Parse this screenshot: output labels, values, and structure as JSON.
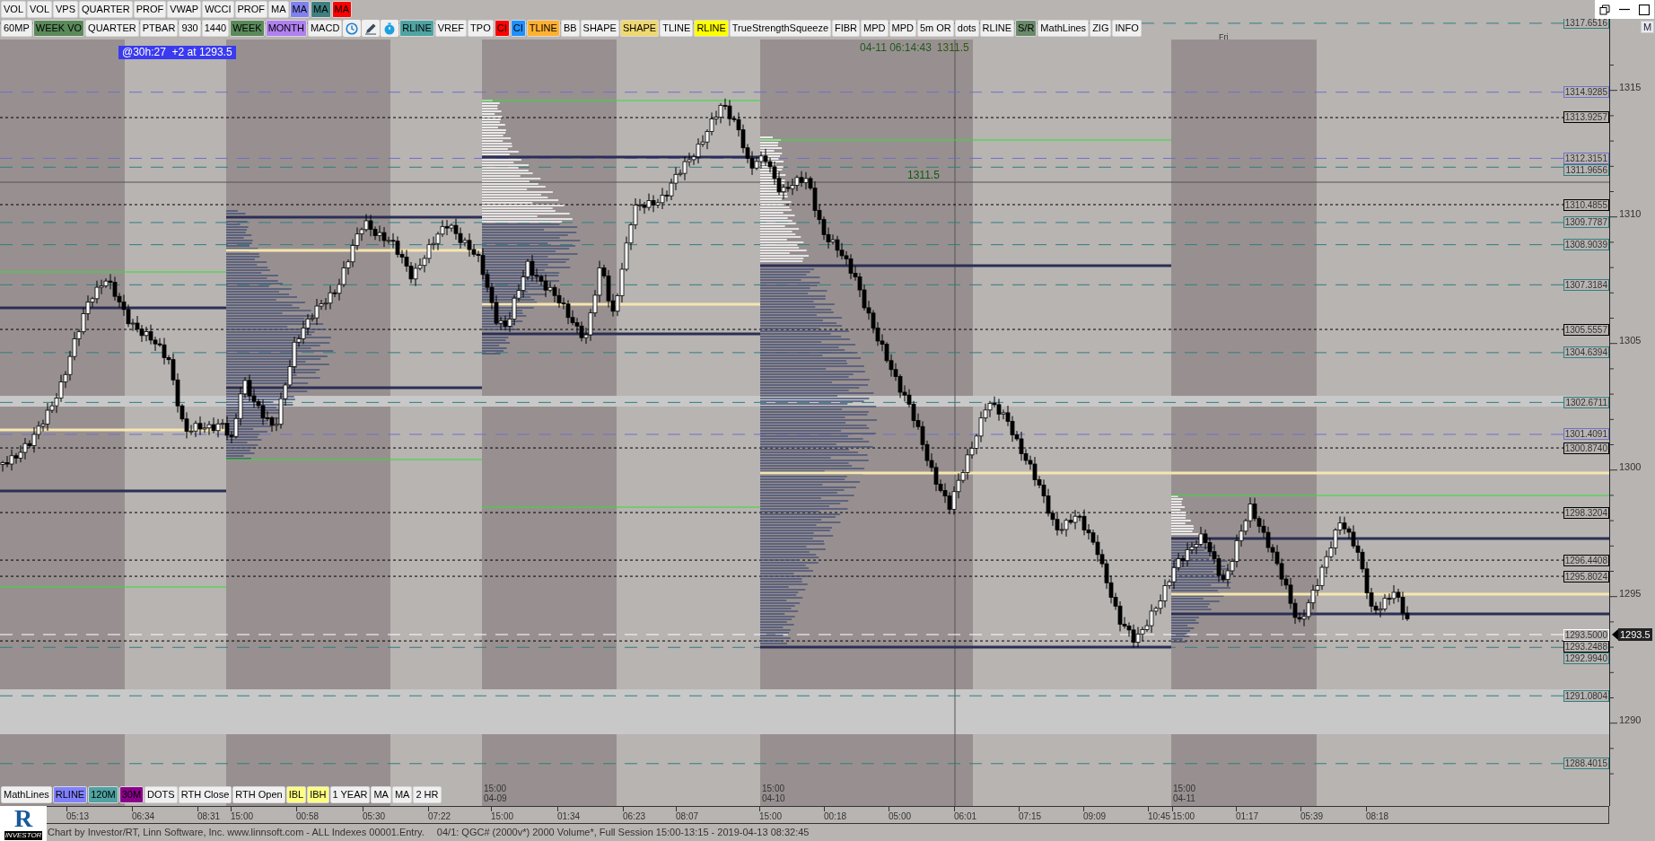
{
  "toolbar_top": [
    {
      "label": "VOL",
      "color": "#f0f0f0"
    },
    {
      "label": "VOL",
      "color": "#f0f0f0"
    },
    {
      "label": "VPS",
      "color": "#f0f0f0"
    },
    {
      "label": "QUARTER",
      "color": "#f0f0f0"
    },
    {
      "label": "PROF",
      "color": "#f0f0f0"
    },
    {
      "label": "VWAP",
      "color": "#f0f0f0"
    },
    {
      "label": "WCCI",
      "color": "#f0f0f0"
    },
    {
      "label": "PROF",
      "color": "#f0f0f0"
    },
    {
      "label": "MA",
      "color": "#f0f0f0"
    },
    {
      "label": "MA",
      "color": "#8080f0"
    },
    {
      "label": "MA",
      "color": "#3f7f7f"
    },
    {
      "label": "MA",
      "color": "#ff0000"
    }
  ],
  "toolbar_second": [
    {
      "kind": "text",
      "label": "60MP",
      "color": "#f0f0f0"
    },
    {
      "kind": "text",
      "label": "WEEK VO",
      "color": "#5a8a5a"
    },
    {
      "kind": "text",
      "label": "QUARTER",
      "color": "#f0f0f0"
    },
    {
      "kind": "text",
      "label": "PTBAR",
      "color": "#f0f0f0"
    },
    {
      "kind": "text",
      "label": "930",
      "color": "#f0f0f0"
    },
    {
      "kind": "text",
      "label": "1440",
      "color": "#f0f0f0"
    },
    {
      "kind": "text",
      "label": "WEEK",
      "color": "#5a8a5a"
    },
    {
      "kind": "text",
      "label": "MONTH",
      "color": "#b080f0"
    },
    {
      "kind": "text",
      "label": "MACD",
      "color": "#f0f0f0"
    },
    {
      "kind": "clock",
      "color": "#f0f0f0"
    },
    {
      "kind": "pencil",
      "color": "#f0f0f0"
    },
    {
      "kind": "timer",
      "color": "#f0f0f0"
    },
    {
      "kind": "text",
      "label": "RLINE",
      "color": "#4fa3a3"
    },
    {
      "kind": "text",
      "label": "VREF",
      "color": "#f0f0f0"
    },
    {
      "kind": "text",
      "label": "TPO",
      "color": "#f0f0f0"
    },
    {
      "kind": "text",
      "label": "CI",
      "color": "#ff0000"
    },
    {
      "kind": "text",
      "label": "CI",
      "color": "#1e90ff"
    },
    {
      "kind": "text",
      "label": "TLINE",
      "color": "#ffb030"
    },
    {
      "kind": "text",
      "label": "BB",
      "color": "#f0f0f0"
    },
    {
      "kind": "text",
      "label": "SHAPE",
      "color": "#f0f0f0"
    },
    {
      "kind": "text",
      "label": "SHAPE",
      "color": "#f0d870"
    },
    {
      "kind": "text",
      "label": "TLINE",
      "color": "#f0f0f0"
    },
    {
      "kind": "text",
      "label": "RLINE",
      "color": "#ffff00"
    },
    {
      "kind": "text",
      "label": "TrueStrengthSqueeze",
      "color": "#f0f0f0"
    },
    {
      "kind": "text",
      "label": "FIBR",
      "color": "#f0f0f0"
    },
    {
      "kind": "text",
      "label": "MPD",
      "color": "#f0f0f0"
    },
    {
      "kind": "text",
      "label": "MPD",
      "color": "#f0f0f0"
    },
    {
      "kind": "text",
      "label": "5m OR",
      "color": "#f0f0f0"
    },
    {
      "kind": "text",
      "label": "dots",
      "color": "#f0f0f0"
    },
    {
      "kind": "text",
      "label": "RLINE",
      "color": "#f0f0f0"
    },
    {
      "kind": "text",
      "label": "S/R",
      "color": "#6a8a6a"
    },
    {
      "kind": "text",
      "label": "MathLines",
      "color": "#f0f0f0"
    },
    {
      "kind": "text",
      "label": "ZIG",
      "color": "#f0f0f0"
    },
    {
      "kind": "text",
      "label": "INFO",
      "color": "#f0f0f0"
    }
  ],
  "chart": {
    "alert_label": "@30h:27  +2 at 1293.5",
    "cursor_time": "04-11 06:14:43",
    "cursor_price": "1311.5",
    "crosshair_price": "1311.5",
    "day_label": "Fri",
    "corner_box": "M",
    "price_levels": [
      {
        "value": "1317.6516",
        "color": "#2f7f7f",
        "kind": "level"
      },
      {
        "value": "1314.9285",
        "color": "#7070c8",
        "kind": "level"
      },
      {
        "value": "1313.9257",
        "color": "#000000",
        "kind": "pivot"
      },
      {
        "value": "1312.3151",
        "color": "#7070c8",
        "kind": "level"
      },
      {
        "value": "1311.9656",
        "color": "#2f7f7f",
        "kind": "level"
      },
      {
        "value": "1310.4855",
        "color": "#000000",
        "kind": "pivot"
      },
      {
        "value": "1309.7787",
        "color": "#2f7f7f",
        "kind": "level"
      },
      {
        "value": "1308.9039",
        "color": "#2f7f7f",
        "kind": "level"
      },
      {
        "value": "1307.3184",
        "color": "#2f7f7f",
        "kind": "level"
      },
      {
        "value": "1305.5557",
        "color": "#000000",
        "kind": "pivot"
      },
      {
        "value": "1304.6394",
        "color": "#2f7f7f",
        "kind": "level"
      },
      {
        "value": "1302.6711",
        "color": "#2f7f7f",
        "kind": "level"
      },
      {
        "value": "1301.4091",
        "color": "#7070c8",
        "kind": "level"
      },
      {
        "value": "1300.8740",
        "color": "#000000",
        "kind": "pivot"
      },
      {
        "value": "1298.3204",
        "color": "#000000",
        "kind": "pivot"
      },
      {
        "value": "1296.4408",
        "color": "#000000",
        "kind": "pivot"
      },
      {
        "value": "1295.8024",
        "color": "#000000",
        "kind": "pivot"
      },
      {
        "value": "1293.5000",
        "color": "#ffffff",
        "kind": "level"
      },
      {
        "value": "1293.2488",
        "color": "#000000",
        "kind": "pivot"
      },
      {
        "value": "1292.9940",
        "color": "#2f7f7f",
        "kind": "level"
      },
      {
        "value": "1291.0804",
        "color": "#2f7f7f",
        "kind": "level"
      },
      {
        "value": "1288.4015",
        "color": "#2f7f7f",
        "kind": "level"
      }
    ],
    "session_markers": [
      {
        "time": "15:00",
        "date": "04-09"
      },
      {
        "time": "15:00",
        "date": "04-10"
      },
      {
        "time": "15:00",
        "date": "04-11"
      }
    ]
  },
  "price_axis": [
    "1315",
    "1310",
    "1305",
    "1300",
    "1295",
    "1290"
  ],
  "last_price": "1293.5",
  "toolbar_bottom": [
    {
      "label": "MathLines",
      "color": "#f0f0f0"
    },
    {
      "label": "RLINE",
      "color": "#8080ff"
    },
    {
      "label": "120M",
      "color": "#4fa3a3"
    },
    {
      "label": "30M",
      "color": "#8b008b"
    },
    {
      "label": "DOTS",
      "color": "#f0f0f0"
    },
    {
      "label": "RTH Close",
      "color": "#f0f0f0"
    },
    {
      "label": "RTH Open",
      "color": "#f0f0f0"
    },
    {
      "label": "IBL",
      "color": "#ffff80"
    },
    {
      "label": "IBH",
      "color": "#ffff80"
    },
    {
      "label": "1 YEAR",
      "color": "#f0f0f0"
    },
    {
      "label": "MA",
      "color": "#f0f0f0"
    },
    {
      "label": "MA",
      "color": "#f0f0f0"
    },
    {
      "label": "2 HR",
      "color": "#f0f0f0"
    }
  ],
  "time_axis": [
    "05:13",
    "06:34",
    "08:31",
    "15:00",
    "00:58",
    "05:30",
    "07:22",
    "15:00",
    "01:34",
    "06:23",
    "08:07",
    "15:00",
    "00:18",
    "05:00",
    "06:01",
    "07:15",
    "09:09",
    "10:45",
    "15:00",
    "01:17",
    "05:39",
    "08:18"
  ],
  "logo": {
    "letter": "R",
    "band": "INVESTOR"
  },
  "status_bar": [
    "Chart by Investor/RT, Linn Software, Inc. www.linnsoft.com - ALL Indexes 00001.Entry.",
    "04/1: QGC# (2000v*) 2000 Volume*, Full Session 15:00-13:15 - 2019-04-13 08:32:45"
  ]
}
